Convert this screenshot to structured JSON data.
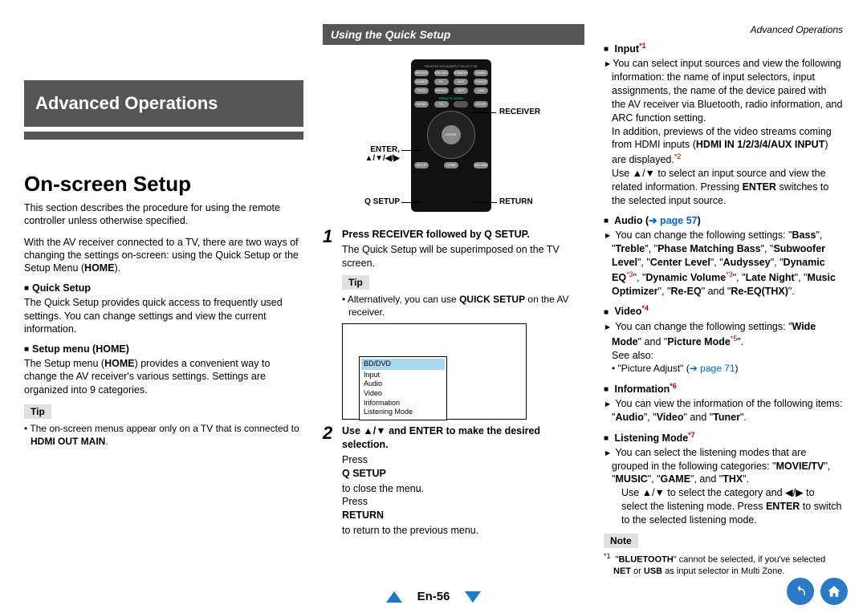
{
  "header": {
    "right_label": "Advanced Operations"
  },
  "chapter": {
    "title": "Advanced Operations"
  },
  "section": {
    "title": "On-screen Setup"
  },
  "col1": {
    "intro": "This section describes the procedure for using the remote controller unless otherwise specified.",
    "para2_a": "With the AV receiver connected to a TV, there are two ways of changing the settings on-screen: using the Quick Setup or the Setup Menu (",
    "para2_home": "HOME",
    "para2_b": ").",
    "qs_head": "Quick Setup",
    "qs_body": "The Quick Setup provides quick access to frequently used settings. You can change settings and view the current information.",
    "sm_head": "Setup menu (HOME)",
    "sm_body_a": "The Setup menu (",
    "sm_body_home": "HOME",
    "sm_body_b": ") provides a convenient way to change the AV receiver's various settings. Settings are organized into 9 categories.",
    "tip_label": "Tip",
    "tip_body_a": "The on-screen menus appear only on a TV that is connected to ",
    "tip_body_b": "HDMI OUT MAIN",
    "tip_body_c": "."
  },
  "col2": {
    "header": "Using the Quick Setup",
    "labels": {
      "receiver": "RECEIVER",
      "enter_line1": "ENTER,",
      "enter_line2": "▲/▼/◀/▶",
      "qsetup": "Q SETUP",
      "return": "RETURN"
    },
    "step1": {
      "num": "1",
      "bold": "Press RECEIVER followed by Q SETUP.",
      "body": "The Quick Setup will be superimposed on the TV screen."
    },
    "tip_label": "Tip",
    "tip_body_a": "Alternatively, you can use ",
    "tip_body_b": "QUICK SETUP",
    "tip_body_c": " on the AV receiver.",
    "osd": {
      "line1": "BD/DVD",
      "line2": "Input",
      "line3": "Audio",
      "line4": "Video",
      "line5": "Information",
      "line6": "Listening Mode"
    },
    "step2": {
      "num": "2",
      "bold": "Use ▲/▼ and ENTER to make the desired selection.",
      "body_a": "Press ",
      "body_b": "Q SETUP",
      "body_c": " to close the menu.",
      "body_d": "Press ",
      "body_e": "RETURN",
      "body_f": " to return to the previous menu."
    }
  },
  "col3": {
    "input": {
      "head": "Input",
      "sup": "*1",
      "body1": "You can select input sources and view the following information: the name of input selectors, input assignments, the name of the device paired with the AV receiver via Bluetooth, radio information, and ARC function setting.",
      "body2_a": "In addition, previews of the video streams coming from HDMI inputs (",
      "body2_b": "HDMI IN 1/2/3/4/AUX INPUT",
      "body2_c": ") are displayed.",
      "body2_sup": "*2",
      "body3_a": "Use ▲/▼ to select an input source and view the related information. Pressing ",
      "body3_b": "ENTER",
      "body3_c": " switches to the selected input source."
    },
    "audio": {
      "head": "Audio (",
      "link": "➔ page 57",
      "head_b": ")",
      "body": "You can change the following settings: \"Bass\", \"Treble\", \"Phase Matching Bass\", \"Subwoofer Level\", \"Center Level\", \"Audyssey\", \"Dynamic EQ*3\", \"Dynamic Volume*3\", \"Late Night\", \"Music Optimizer\", \"Re-EQ\" and \"Re-EQ(THX)\"."
    },
    "video": {
      "head": "Video",
      "sup": "*4",
      "body_a": "You can change the following settings: \"",
      "body_b": "Wide Mode",
      "body_c": "\" and \"",
      "body_d": "Picture Mode",
      "body_sup": "*5",
      "body_e": "\".",
      "see": "See also:",
      "see_item": "\"Picture Adjust\" (",
      "see_link": "➔ page 71",
      "see_end": ")"
    },
    "info": {
      "head": "Information",
      "sup": "*6",
      "body": "You can view the information of the following items: \"Audio\", \"Video\" and \"Tuner\"."
    },
    "lm": {
      "head": "Listening Mode",
      "sup": "*7",
      "body": "You can select the listening modes that are grouped in the following categories: \"MOVIE/TV\", \"MUSIC\", \"GAME\", and \"THX\".",
      "body2_a": "Use ▲/▼ to select the category and ◀/▶ to select the listening mode. Press ",
      "body2_b": "ENTER",
      "body2_c": " to switch to the selected listening mode."
    },
    "note_label": "Note",
    "note_body_a": "\"",
    "note_body_b": "BLUETOOTH",
    "note_body_c": "\" cannot be selected, if you've selected ",
    "note_body_d": "NET",
    "note_body_e": " or ",
    "note_body_f": "USB",
    "note_body_g": " as input selector in Multi Zone.",
    "note_sup": "*1"
  },
  "footer": {
    "page": "En-56"
  }
}
